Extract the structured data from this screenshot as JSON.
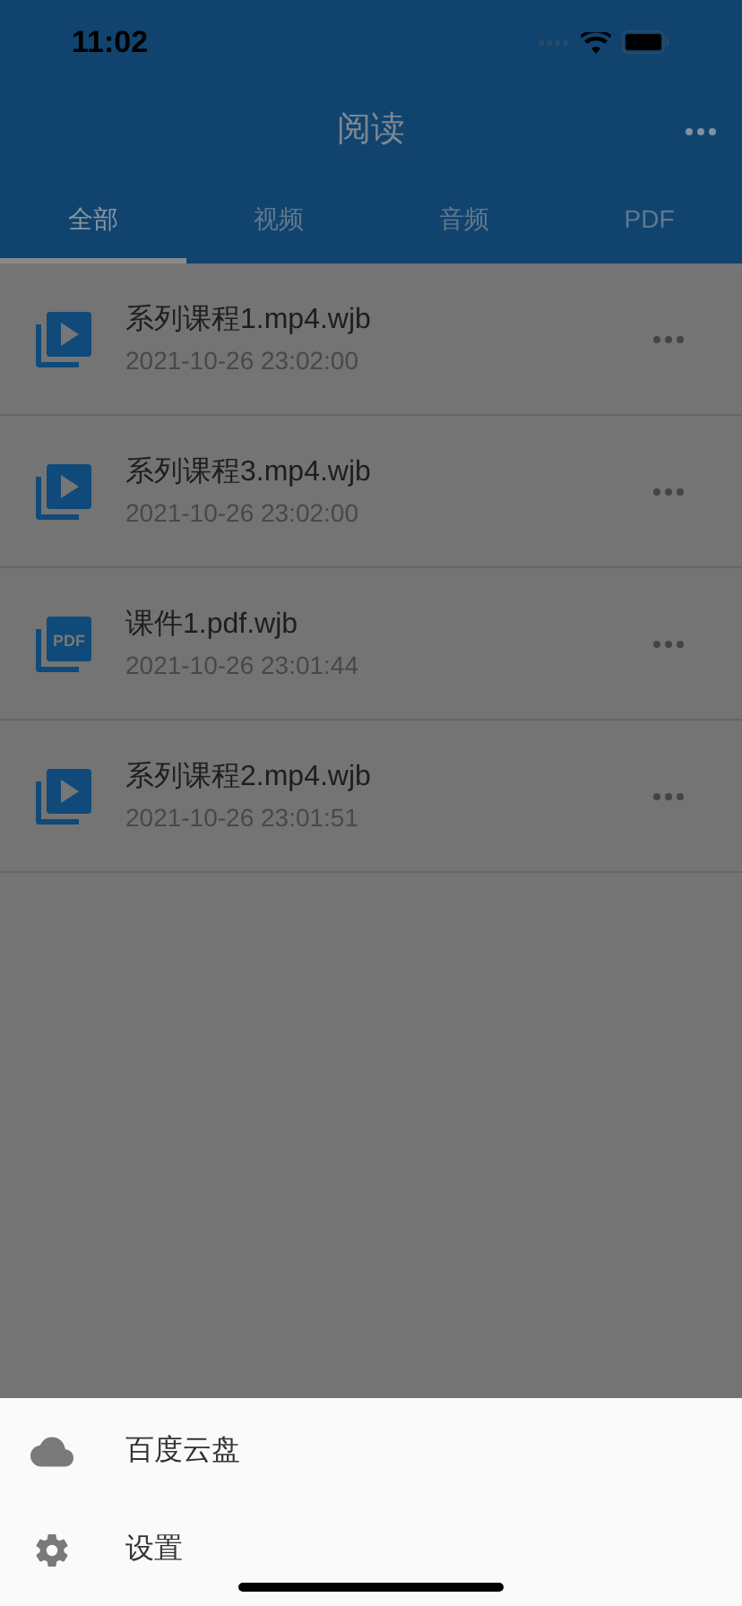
{
  "status_bar": {
    "time": "11:02"
  },
  "header": {
    "title": "阅读"
  },
  "tabs": [
    {
      "label": "全部",
      "selected": true
    },
    {
      "label": "视频",
      "selected": false
    },
    {
      "label": "音频",
      "selected": false
    },
    {
      "label": "PDF",
      "selected": false
    }
  ],
  "files": [
    {
      "kind": "video",
      "name": "系列课程1.mp4.wjb",
      "date": "2021-10-26 23:02:00"
    },
    {
      "kind": "video",
      "name": "系列课程3.mp4.wjb",
      "date": "2021-10-26 23:02:00"
    },
    {
      "kind": "pdf",
      "icon_text": "PDF",
      "name": "课件1.pdf.wjb",
      "date": "2021-10-26 23:01:44"
    },
    {
      "kind": "video",
      "name": "系列课程2.mp4.wjb",
      "date": "2021-10-26 23:01:51"
    }
  ],
  "sheet": [
    {
      "kind": "cloud",
      "label": "百度云盘"
    },
    {
      "kind": "settings",
      "label": "设置"
    }
  ]
}
